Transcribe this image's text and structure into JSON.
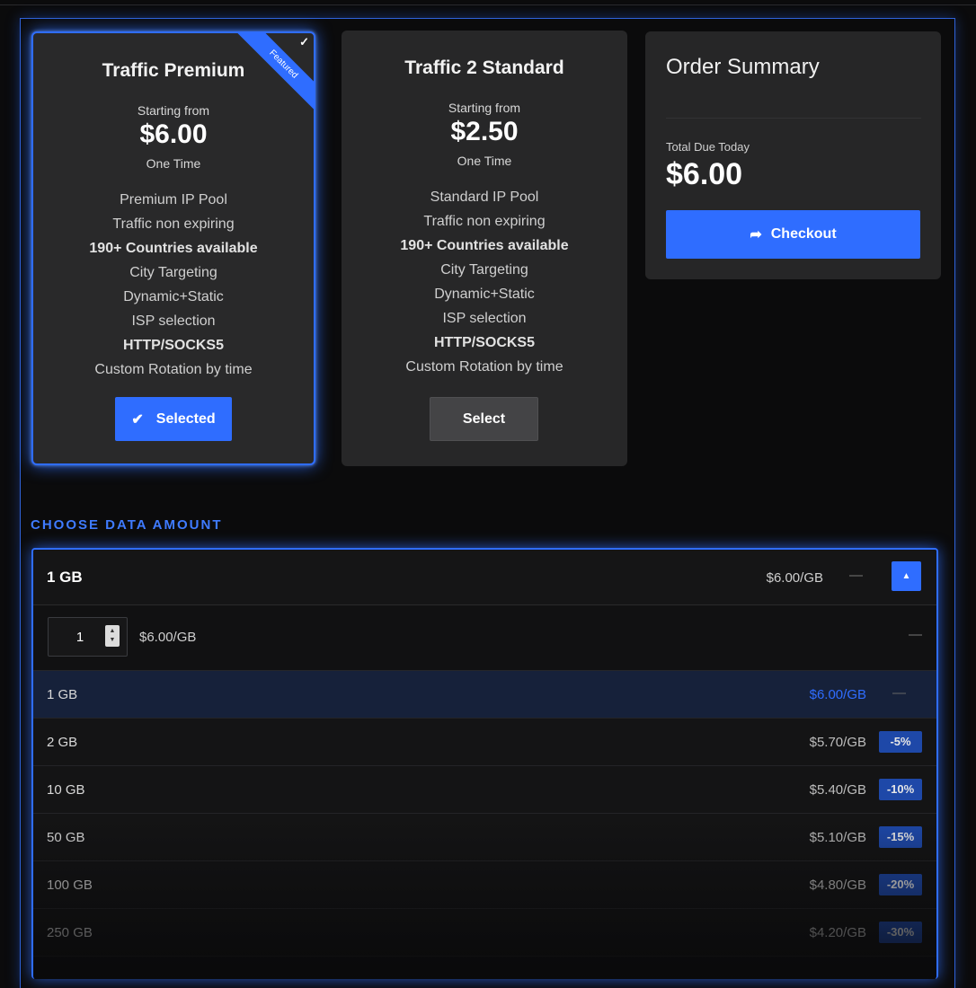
{
  "plans": [
    {
      "name": "Traffic Premium",
      "starting_label": "Starting from",
      "price": "$6.00",
      "cycle": "One Time",
      "ribbon": "Featured",
      "features": [
        "Premium IP Pool",
        "Traffic non expiring",
        "190+ Countries available",
        "City Targeting",
        "Dynamic+Static",
        "ISP selection",
        "HTTP/SOCKS5",
        "Custom Rotation by time"
      ],
      "button": "Selected"
    },
    {
      "name": "Traffic 2 Standard",
      "starting_label": "Starting from",
      "price": "$2.50",
      "cycle": "One Time",
      "features": [
        "Standard IP Pool",
        "Traffic non expiring",
        "190+ Countries available",
        "City Targeting",
        "Dynamic+Static",
        "ISP selection",
        "HTTP/SOCKS5",
        "Custom Rotation by time"
      ],
      "button": "Select"
    }
  ],
  "summary": {
    "title": "Order Summary",
    "due_label": "Total Due Today",
    "due": "$6.00",
    "checkout": "Checkout"
  },
  "data_amount": {
    "title": "CHOOSE DATA AMOUNT",
    "selected": "1 GB",
    "selected_rate": "$6.00/GB",
    "dash": "—",
    "quantity": "1",
    "quantity_rate": "$6.00/GB",
    "options": [
      {
        "size": "1 GB",
        "rate": "$6.00/GB",
        "discount": "—"
      },
      {
        "size": "2 GB",
        "rate": "$5.70/GB",
        "discount": "-5%"
      },
      {
        "size": "10 GB",
        "rate": "$5.40/GB",
        "discount": "-10%"
      },
      {
        "size": "50 GB",
        "rate": "$5.10/GB",
        "discount": "-15%"
      },
      {
        "size": "100 GB",
        "rate": "$4.80/GB",
        "discount": "-20%"
      },
      {
        "size": "250 GB",
        "rate": "$4.20/GB",
        "discount": "-30%"
      }
    ]
  },
  "colors": {
    "accent": "#2f6dff",
    "background": "#0b0b0c",
    "card": "#262627"
  },
  "icons": {
    "check": "check-icon",
    "arrow": "share-arrow-icon",
    "caret_up": "caret-up-icon"
  }
}
